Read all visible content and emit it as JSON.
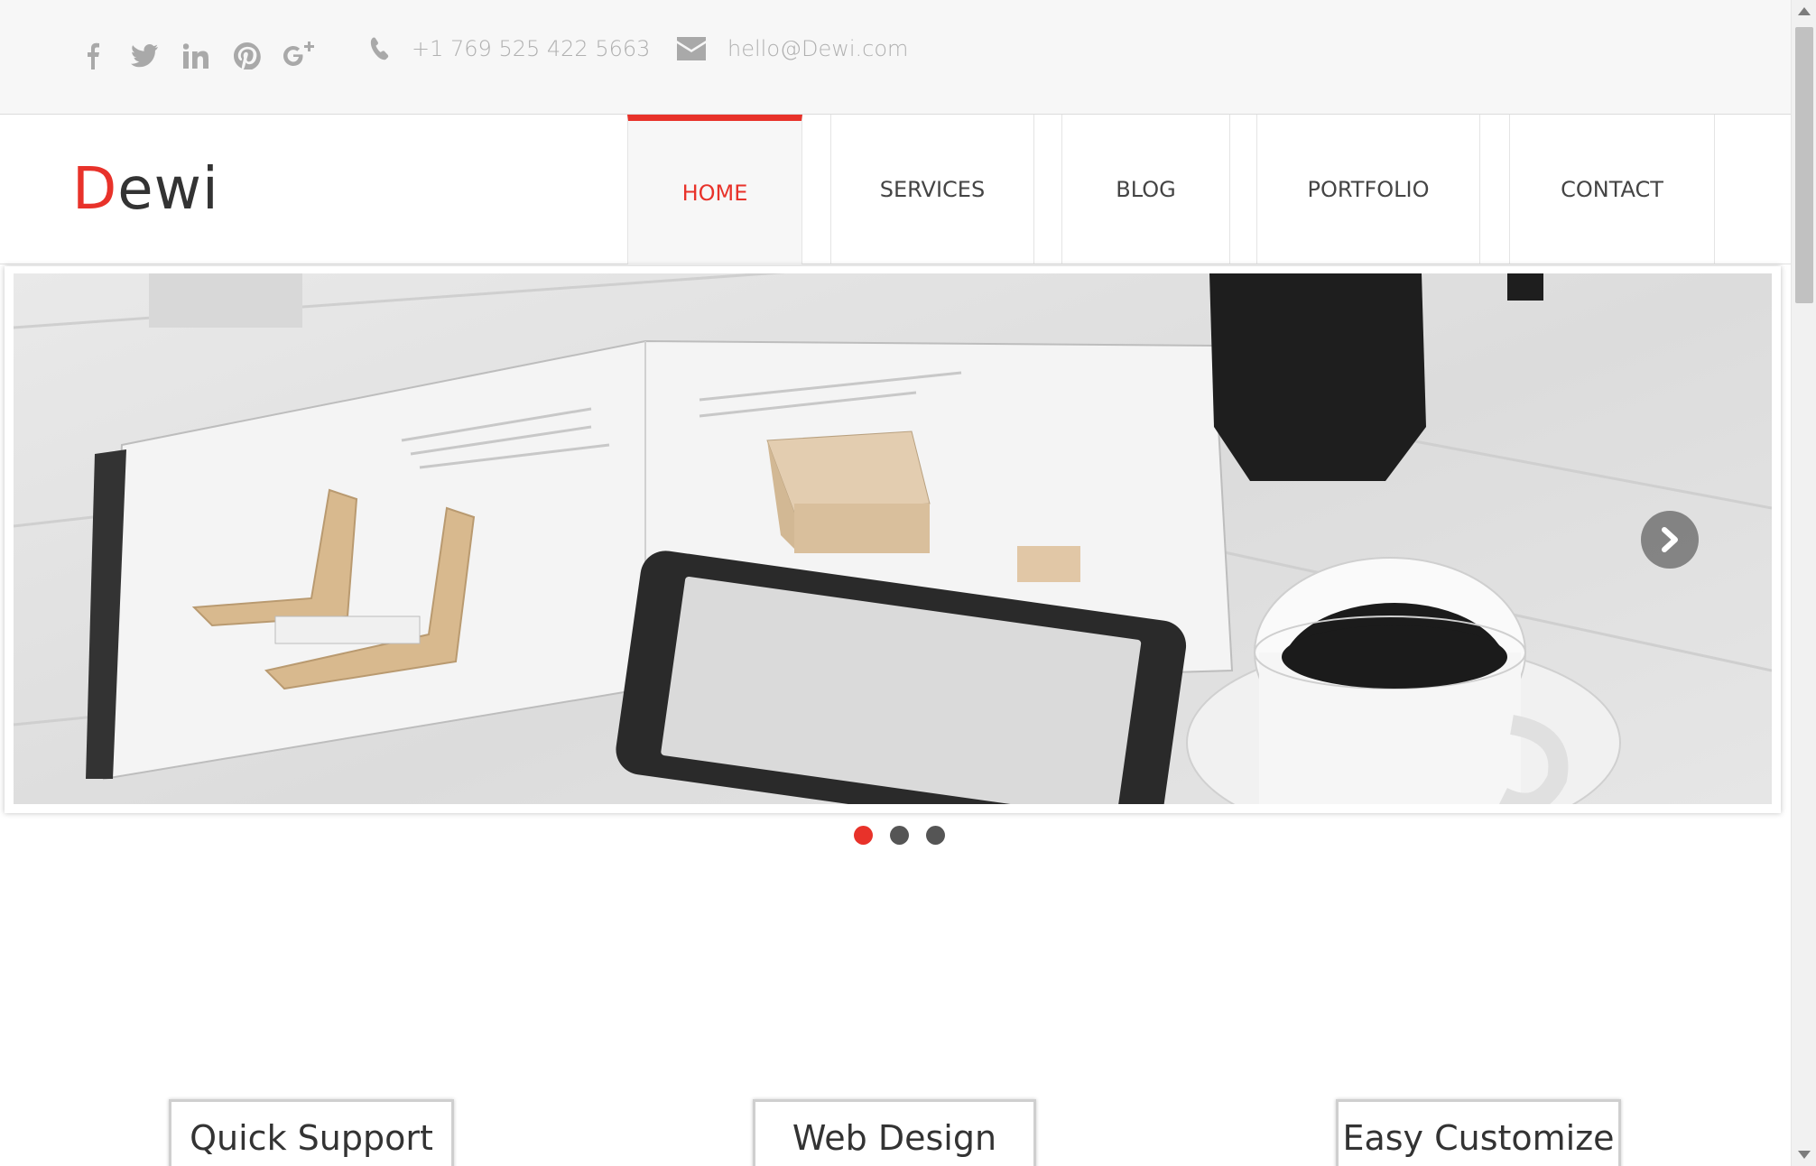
{
  "topbar": {
    "social_icons": [
      "facebook-icon",
      "twitter-icon",
      "linkedin-icon",
      "pinterest-icon",
      "google-plus-icon"
    ],
    "phone": "+1 769 525 422 5663",
    "email": "hello@Dewi.com"
  },
  "header": {
    "logo_first": "D",
    "logo_rest": "ewi"
  },
  "nav": {
    "items": [
      {
        "label": "HOME",
        "active": true
      },
      {
        "label": "SERVICES",
        "active": false
      },
      {
        "label": "BLOG",
        "active": false
      },
      {
        "label": "PORTFOLIO",
        "active": false
      },
      {
        "label": "CONTACT",
        "active": false
      }
    ]
  },
  "slider": {
    "slide_count": 3,
    "active_index": 0
  },
  "features": [
    {
      "title": "Quick Support"
    },
    {
      "title": "Web Design"
    },
    {
      "title": "Easy Customize"
    }
  ],
  "colors": {
    "accent": "#e8322a",
    "text": "#333333",
    "muted": "#a9a9a9"
  }
}
